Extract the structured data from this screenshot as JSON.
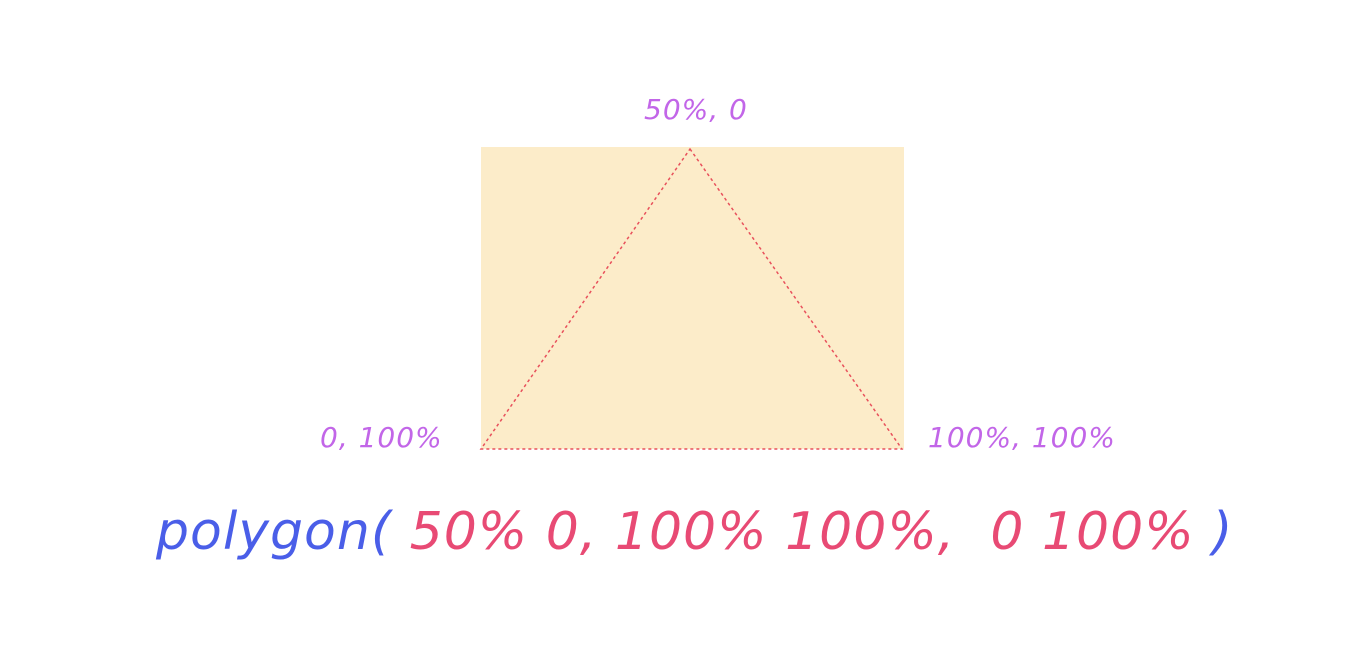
{
  "colors": {
    "box_fill": "#fcecc9",
    "triangle_stroke": "#e8505b",
    "label_color": "#c266e8",
    "function_color": "#4a5ee8",
    "argument_color": "#e84a74"
  },
  "labels": {
    "top": "50%, 0",
    "bottom_left": "0, 100%",
    "bottom_right": "100%, 100%"
  },
  "formula": {
    "function": "polygon(",
    "arguments": " 50% 0, 100% 100%,  0 100% ",
    "close": ")"
  }
}
